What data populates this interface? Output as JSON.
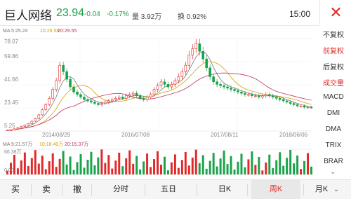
{
  "header": {
    "title": "巨人网络",
    "price": "23.94",
    "change": "-0.04",
    "change_pct": "-0.17%",
    "volume": "量 3.92万",
    "turnover": "换 0.92%",
    "time": "15:00"
  },
  "ma_main": {
    "ma5_label": "MA 5:25.24",
    "ma10_label": "10:26.58",
    "ma20_label": "20:29.55"
  },
  "ma_vol": {
    "ma5_label": "MA 5:21.57万",
    "ma10_label": "10:18.40万",
    "ma20_label": "20:15.37万"
  },
  "y_axis_price": [
    "78.07",
    "59.86",
    "41.66",
    "23.45",
    "5.25"
  ],
  "x_axis_dates": [
    "2014/08/29",
    "2016/07/08",
    "2017/08/11",
    "2018/06/06"
  ],
  "y_axis_volume": [
    "66.38万",
    "0.00"
  ],
  "side_menu": [
    {
      "label": "不复权",
      "active": false
    },
    {
      "label": "前复权",
      "active": true
    },
    {
      "label": "后复权",
      "active": false
    },
    {
      "label": "成交量",
      "active": true
    },
    {
      "label": "MACD",
      "active": false
    },
    {
      "label": "DMI",
      "active": false
    },
    {
      "label": "DMA",
      "active": false
    },
    {
      "label": "TRIX",
      "active": false
    },
    {
      "label": "BRAR",
      "active": false
    }
  ],
  "bottom_buttons": [
    "买",
    "卖",
    "撤"
  ],
  "bottom_tabs": [
    {
      "label": "分时",
      "active": false
    },
    {
      "label": "五日",
      "active": false
    },
    {
      "label": "日K",
      "active": false
    },
    {
      "label": "周K",
      "active": true
    },
    {
      "label": "月K",
      "active": false
    }
  ],
  "icons": {
    "close": "close-icon",
    "side_scroll": "chevron-down-icon",
    "month_dropdown": "chevron-down-icon"
  },
  "colors": {
    "up": "#e02a2a",
    "down": "#1aa34a",
    "ma5": "#777777",
    "ma10": "#d8a000",
    "ma20": "#c03060"
  },
  "chart_data": {
    "type": "candlestick",
    "y_range": [
      5.25,
      78.07
    ],
    "approx_weekly_closes": [
      6,
      6,
      7,
      8,
      9,
      10,
      11,
      13,
      15,
      18,
      22,
      26,
      31,
      38,
      45,
      57,
      52,
      46,
      40,
      36,
      34,
      32,
      30,
      29,
      28,
      27,
      26,
      27,
      28,
      29,
      30,
      31,
      32,
      31,
      33,
      34,
      35,
      33,
      31,
      30,
      32,
      34,
      38,
      41,
      44,
      42,
      40,
      42,
      45,
      48,
      52,
      57,
      65,
      70,
      74,
      68,
      62,
      55,
      48,
      44,
      42,
      41,
      40,
      39,
      38,
      37,
      36,
      35,
      34,
      34,
      33,
      33,
      32,
      33,
      34,
      33,
      32,
      31,
      30,
      29,
      28,
      27,
      26,
      25,
      25,
      24,
      24,
      23.94
    ]
  }
}
